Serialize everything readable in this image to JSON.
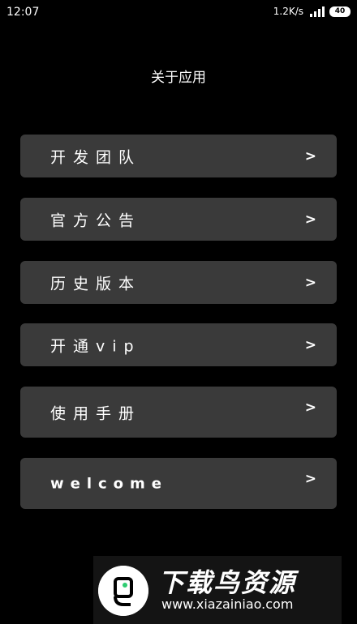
{
  "status_bar": {
    "time": "12:07",
    "net_speed": "1.2K/s",
    "battery": "40"
  },
  "header": {
    "title": "关于应用"
  },
  "menu": {
    "items": [
      {
        "label": "开发团队",
        "chevron": ">"
      },
      {
        "label": "官方公告",
        "chevron": ">"
      },
      {
        "label": "历史版本",
        "chevron": ">"
      },
      {
        "label": "开通vip",
        "chevron": ">"
      },
      {
        "label": "使用手册",
        "chevron": ">"
      },
      {
        "label": "welcome",
        "chevron": ">"
      }
    ]
  },
  "watermark": {
    "title": "下载鸟资源",
    "url": "www.xiazainiao.com"
  }
}
